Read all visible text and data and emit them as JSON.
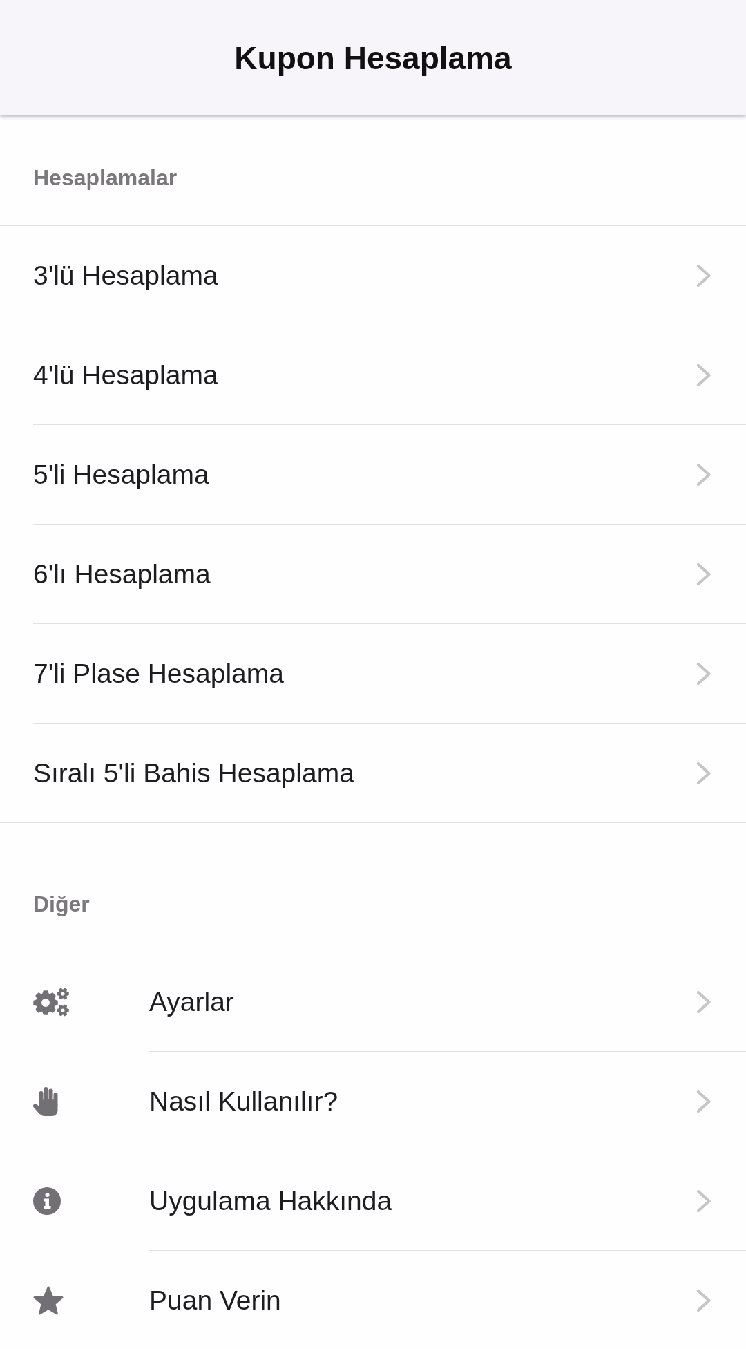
{
  "app_bar": {
    "title": "Kupon Hesaplama"
  },
  "sections": [
    {
      "kind": "plain",
      "title": "Hesaplamalar",
      "items": [
        {
          "label": "3'lü Hesaplama"
        },
        {
          "label": "4'lü Hesaplama"
        },
        {
          "label": "5'li Hesaplama"
        },
        {
          "label": "6'lı Hesaplama"
        },
        {
          "label": "7'li Plase Hesaplama"
        },
        {
          "label": "Sıralı 5'li Bahis Hesaplama"
        }
      ]
    },
    {
      "kind": "icons",
      "title": "Diğer",
      "items": [
        {
          "label": "Ayarlar"
        },
        {
          "label": "Nasıl Kullanılır?"
        },
        {
          "label": "Uygulama Hakkında"
        },
        {
          "label": "Puan Verin"
        }
      ]
    }
  ]
}
